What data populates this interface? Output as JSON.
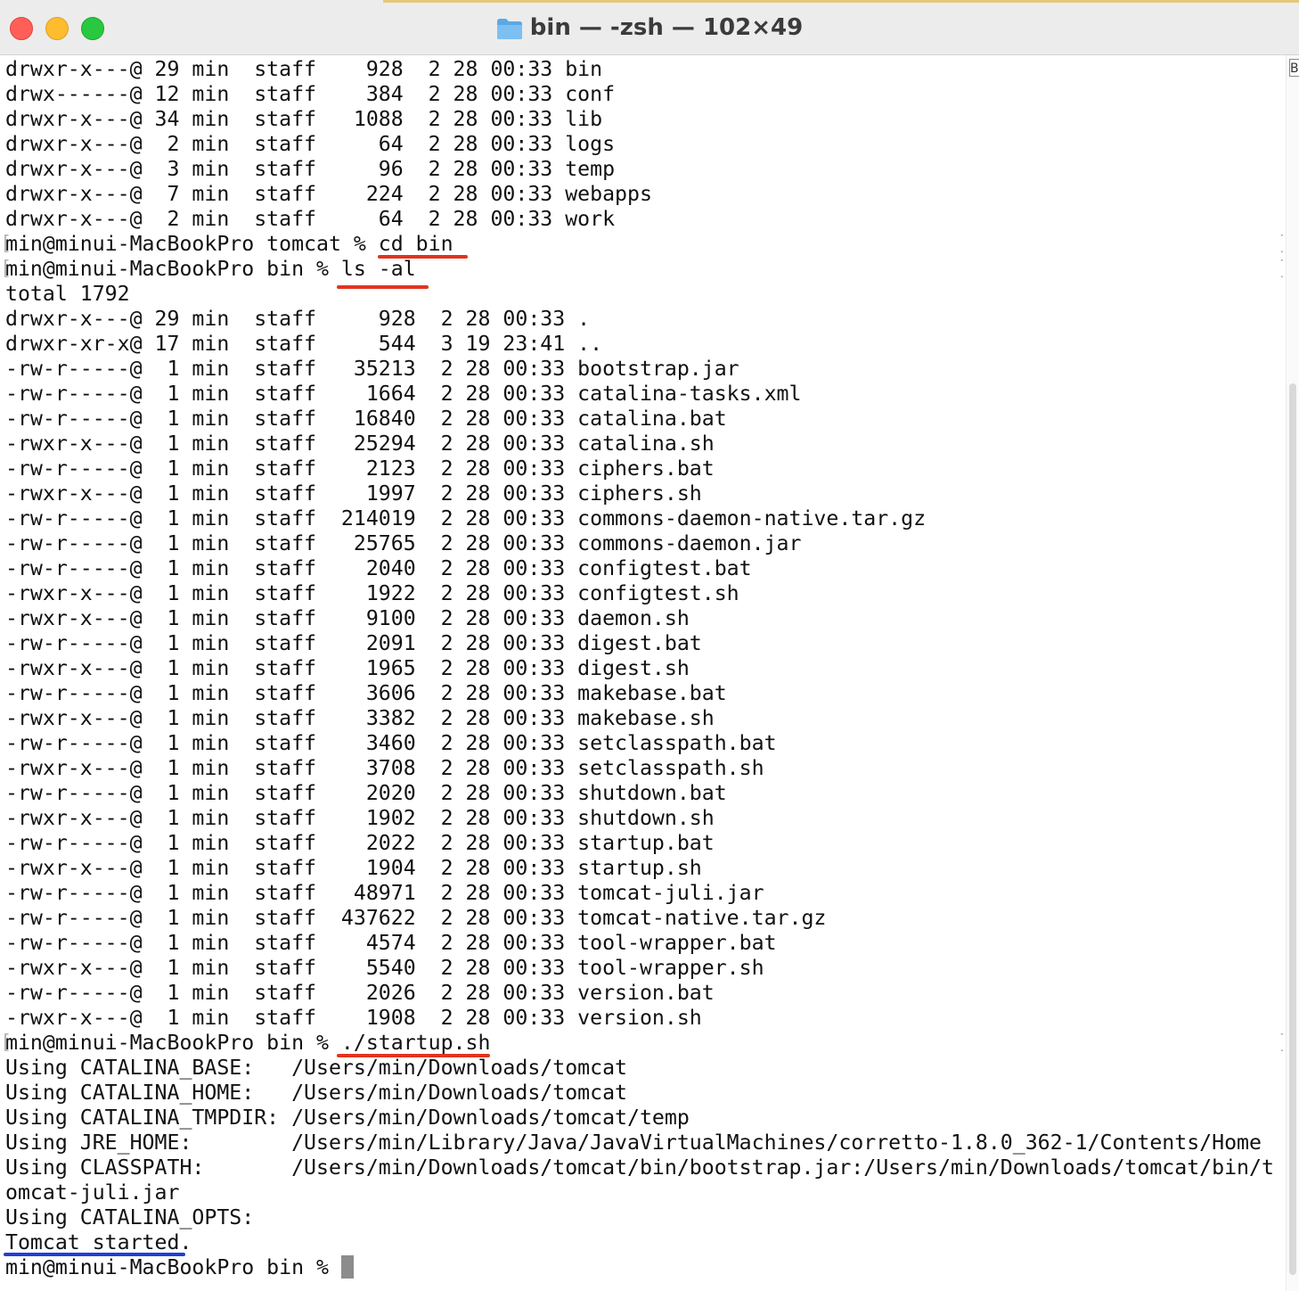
{
  "window": {
    "title": "bin — -zsh — 102×49",
    "title_icon": "folder-icon",
    "scroll_marker": "B"
  },
  "colors": {
    "highlight_red": "#e2331f",
    "highlight_blue": "#1f3fd6",
    "text": "#111111"
  },
  "terminal": {
    "lines": [
      "drwxr-x---@ 29 min  staff    928  2 28 00:33 bin",
      "drwx------@ 12 min  staff    384  2 28 00:33 conf",
      "drwxr-x---@ 34 min  staff   1088  2 28 00:33 lib",
      "drwxr-x---@  2 min  staff     64  2 28 00:33 logs",
      "drwxr-x---@  3 min  staff     96  2 28 00:33 temp",
      "drwxr-x---@  7 min  staff    224  2 28 00:33 webapps",
      "drwxr-x---@  2 min  staff     64  2 28 00:33 work",
      "min@minui-MacBookPro tomcat % cd bin",
      "min@minui-MacBookPro bin % ls -al",
      "total 1792",
      "drwxr-x---@ 29 min  staff     928  2 28 00:33 .",
      "drwxr-xr-x@ 17 min  staff     544  3 19 23:41 ..",
      "-rw-r-----@  1 min  staff   35213  2 28 00:33 bootstrap.jar",
      "-rw-r-----@  1 min  staff    1664  2 28 00:33 catalina-tasks.xml",
      "-rw-r-----@  1 min  staff   16840  2 28 00:33 catalina.bat",
      "-rwxr-x---@  1 min  staff   25294  2 28 00:33 catalina.sh",
      "-rw-r-----@  1 min  staff    2123  2 28 00:33 ciphers.bat",
      "-rwxr-x---@  1 min  staff    1997  2 28 00:33 ciphers.sh",
      "-rw-r-----@  1 min  staff  214019  2 28 00:33 commons-daemon-native.tar.gz",
      "-rw-r-----@  1 min  staff   25765  2 28 00:33 commons-daemon.jar",
      "-rw-r-----@  1 min  staff    2040  2 28 00:33 configtest.bat",
      "-rwxr-x---@  1 min  staff    1922  2 28 00:33 configtest.sh",
      "-rwxr-x---@  1 min  staff    9100  2 28 00:33 daemon.sh",
      "-rw-r-----@  1 min  staff    2091  2 28 00:33 digest.bat",
      "-rwxr-x---@  1 min  staff    1965  2 28 00:33 digest.sh",
      "-rw-r-----@  1 min  staff    3606  2 28 00:33 makebase.bat",
      "-rwxr-x---@  1 min  staff    3382  2 28 00:33 makebase.sh",
      "-rw-r-----@  1 min  staff    3460  2 28 00:33 setclasspath.bat",
      "-rwxr-x---@  1 min  staff    3708  2 28 00:33 setclasspath.sh",
      "-rw-r-----@  1 min  staff    2020  2 28 00:33 shutdown.bat",
      "-rwxr-x---@  1 min  staff    1902  2 28 00:33 shutdown.sh",
      "-rw-r-----@  1 min  staff    2022  2 28 00:33 startup.bat",
      "-rwxr-x---@  1 min  staff    1904  2 28 00:33 startup.sh",
      "-rw-r-----@  1 min  staff   48971  2 28 00:33 tomcat-juli.jar",
      "-rw-r-----@  1 min  staff  437622  2 28 00:33 tomcat-native.tar.gz",
      "-rw-r-----@  1 min  staff    4574  2 28 00:33 tool-wrapper.bat",
      "-rwxr-x---@  1 min  staff    5540  2 28 00:33 tool-wrapper.sh",
      "-rw-r-----@  1 min  staff    2026  2 28 00:33 version.bat",
      "-rwxr-x---@  1 min  staff    1908  2 28 00:33 version.sh",
      "min@minui-MacBookPro bin % ./startup.sh",
      "Using CATALINA_BASE:   /Users/min/Downloads/tomcat",
      "Using CATALINA_HOME:   /Users/min/Downloads/tomcat",
      "Using CATALINA_TMPDIR: /Users/min/Downloads/tomcat/temp",
      "Using JRE_HOME:        /Users/min/Library/Java/JavaVirtualMachines/corretto-1.8.0_362-1/Contents/Home",
      "Using CLASSPATH:       /Users/min/Downloads/tomcat/bin/bootstrap.jar:/Users/min/Downloads/tomcat/bin/t",
      "omcat-juli.jar",
      "Using CATALINA_OPTS:",
      "Tomcat started.",
      "min@minui-MacBookPro bin % "
    ],
    "prompt_line_indices": [
      7,
      8,
      39
    ],
    "bracket_left": "[",
    "bracket_right": "]"
  }
}
